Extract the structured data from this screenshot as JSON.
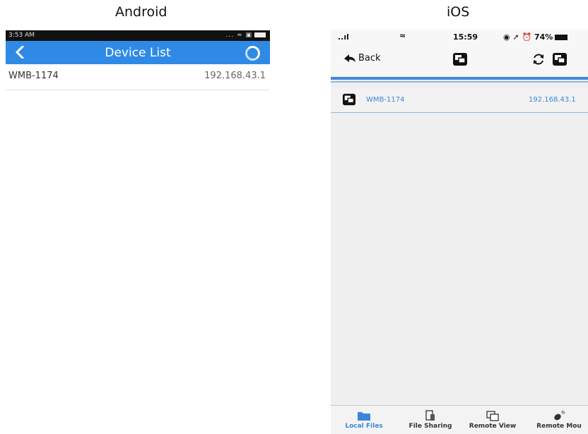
{
  "captions": {
    "android": "Android",
    "ios": "iOS"
  },
  "android": {
    "status_time": "3:53 AM",
    "status_icons": "... ≈ ▣",
    "title": "Device List",
    "devices": [
      {
        "name": "WMB-1174",
        "ip": "192.168.43.1"
      }
    ],
    "accent": "#2f8ae6"
  },
  "ios": {
    "status_signal": "..ıl",
    "status_wifi": "≈",
    "status_time": "15:59",
    "status_right": "◉ ➚ ⏰ 74%",
    "back_label": "Back",
    "devices": [
      {
        "name": "WMB-1174",
        "ip": "192.168.43.1"
      }
    ],
    "tabs": [
      {
        "label": "Local Files",
        "icon": "folder-icon",
        "active": true
      },
      {
        "label": "File Sharing",
        "icon": "file-sharing-icon"
      },
      {
        "label": "Remote View",
        "icon": "remote-view-icon"
      },
      {
        "label": "Remote Mou",
        "icon": "remote-mouse-icon"
      }
    ],
    "accent": "#3d8cdc"
  }
}
